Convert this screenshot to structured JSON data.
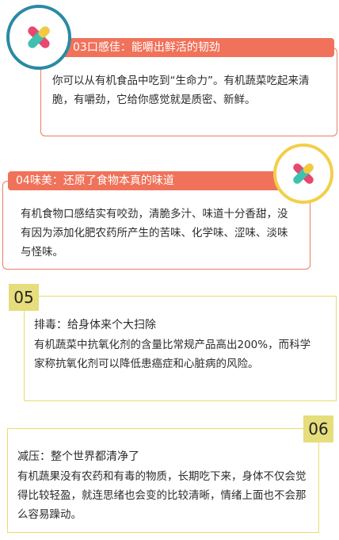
{
  "section03": {
    "banner": "03口感佳：能嚼出鲜活的韧劲",
    "body": "你可以从有机食品中吃到“生命力”。有机蔬菜吃起来清脆，有嚼劲，它给你感觉就是质密、新鲜。",
    "logo_icon": "x-cross-logo-icon",
    "ring_color": "#2a8aa3"
  },
  "section04": {
    "banner": "04味美：还原了食物本真的味道",
    "body": "有机食物口感结实有咬劲，清脆多汁、味道十分香甜，没有因为添加化肥农药所产生的苦味、化学味、涩味、淡味与怪味。",
    "logo_icon": "x-cross-logo-icon",
    "ring_color": "#f2cf4a"
  },
  "section05": {
    "number": "05",
    "title": "排毒：给身体来个大扫除",
    "body": "有机蔬菜中抗氧化剂的含量比常规产品高出200%，而科学家称抗氧化剂可以降低患癌症和心脏病的风险。"
  },
  "section06": {
    "number": "06",
    "title": "减压：整个世界都清净了",
    "body": "有机蔬果没有农药和有毒的物质，长期吃下来，身体不仅会觉得比较轻盈，就连思绪也会变的比较清晰，情绪上面也不会那么容易躁动。"
  },
  "colors": {
    "coral": "#f0725a",
    "yellow": "#e6dd7c",
    "logo_pink": "#e8486f",
    "logo_teal": "#3fc1b0",
    "logo_yellow": "#f5c93e"
  }
}
